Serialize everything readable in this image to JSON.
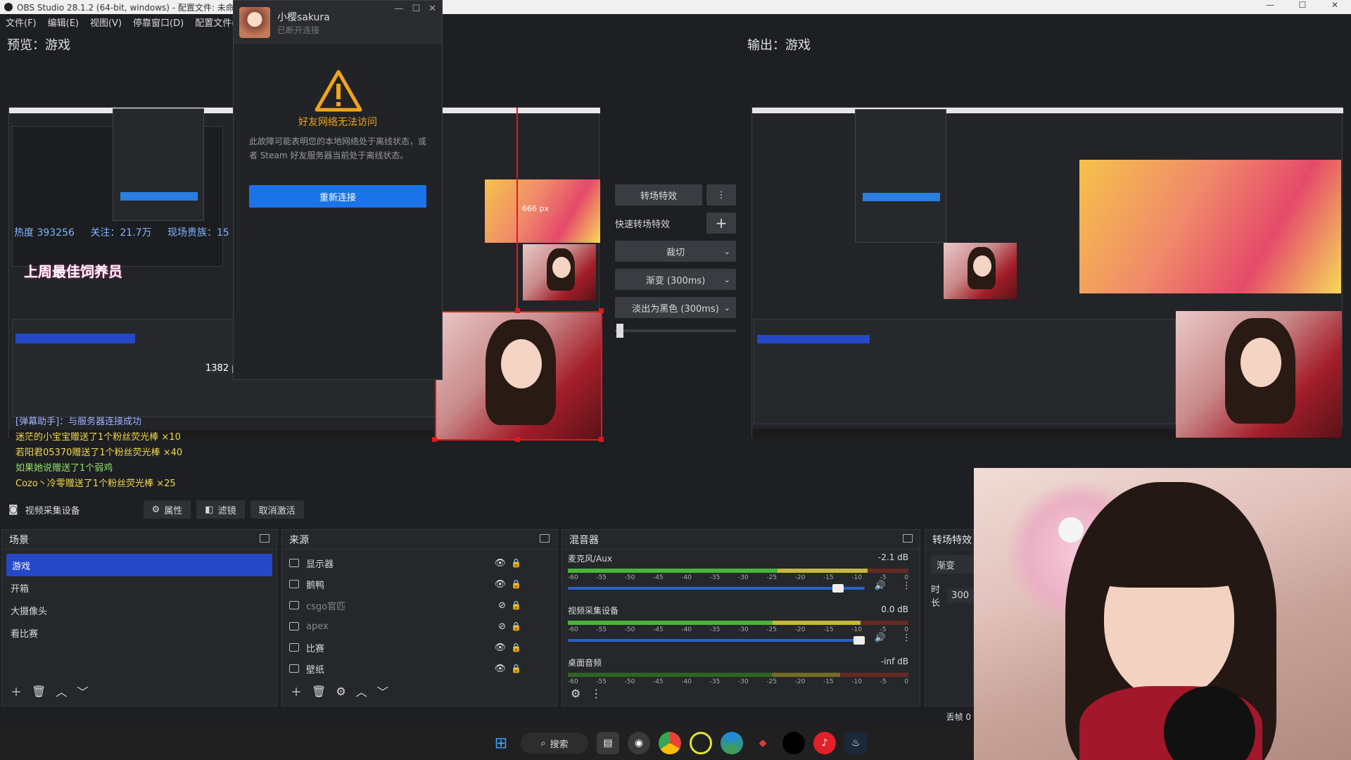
{
  "window": {
    "title": "OBS Studio 28.1.2 (64-bit, windows) - 配置文件: 未命名 - 场",
    "min": "—",
    "max": "☐",
    "close": "✕"
  },
  "menu": [
    "文件(F)",
    "编辑(E)",
    "视图(V)",
    "停靠窗口(D)",
    "配置文件(P"
  ],
  "preview_label": "预览：游戏",
  "program_label": "输出：游戏",
  "dialog": {
    "name": "小樱sakura",
    "status": "已断开连接",
    "warning_title": "好友网络无法访问",
    "warning_text": "此故障可能表明您的本地网络处于离线状态，或者 Steam 好友服务器当前处于离线状态。",
    "button": "重新连接"
  },
  "preview_overlay": {
    "hot_label": "热度",
    "hot_value": "393256",
    "fans": "关注：21.7万",
    "noble": "现场贵族：15",
    "top_feeder": "上周最佳饲养员",
    "px_label": "1382 p",
    "px2": "666 px",
    "chat": [
      {
        "text": "[弹幕助手]：与服务器连接成功",
        "color": "#9fb4ff"
      },
      {
        "text": "迷茫的小宝宝赠送了1个粉丝荧光棒 ×10",
        "color": "#f2d94e"
      },
      {
        "text": "若阳君05370赠送了1个粉丝荧光棒 ×40",
        "color": "#f2d94e"
      },
      {
        "text": "如果她说赠送了1个弱鸡",
        "color": "#8fe26a"
      },
      {
        "text": "Cozo丶冷零赠送了1个粉丝荧光棒 ×25",
        "color": "#f2d94e"
      }
    ]
  },
  "transition_panel": {
    "effects_btn": "转场特效",
    "quick_label": "快速转场特效",
    "items": [
      "裁切",
      "渐变 (300ms)",
      "淡出为黑色 (300ms)"
    ]
  },
  "source_toolbar": {
    "current": "视频采集设备",
    "properties": "属性",
    "filters": "滤镜",
    "deactivate": "取消激活"
  },
  "scenes": {
    "title": "场景",
    "items": [
      "游戏",
      "开箱",
      "大摄像头",
      "看比赛"
    ]
  },
  "sources": {
    "title": "来源",
    "items": [
      {
        "name": "显示器",
        "visible": true
      },
      {
        "name": "鹅鸭",
        "visible": true
      },
      {
        "name": "csgo官匹",
        "visible": false
      },
      {
        "name": "apex",
        "visible": false
      },
      {
        "name": "比赛",
        "visible": true
      },
      {
        "name": "壁纸",
        "visible": true
      }
    ]
  },
  "mixer": {
    "title": "混音器",
    "ticks": [
      "-60",
      "-55",
      "-50",
      "-45",
      "-40",
      "-35",
      "-30",
      "-25",
      "-20",
      "-15",
      "-10",
      "-5",
      "0"
    ],
    "channels": [
      {
        "name": "麦克风/Aux",
        "db": "-2.1 dB",
        "level": 0.88,
        "volume": 0.93
      },
      {
        "name": "视频采集设备",
        "db": "0.0 dB",
        "level": 0.86,
        "volume": 1.0
      },
      {
        "name": "桌面音频",
        "db": "-inf dB",
        "level": 0.0,
        "volume": 1.0
      }
    ]
  },
  "transitions_dock": {
    "title": "转场特效",
    "current": "渐变",
    "duration_label": "时长",
    "duration_value": "300"
  },
  "status": {
    "dropped": "丢帧 0"
  },
  "taskbar": {
    "search": "搜索"
  }
}
